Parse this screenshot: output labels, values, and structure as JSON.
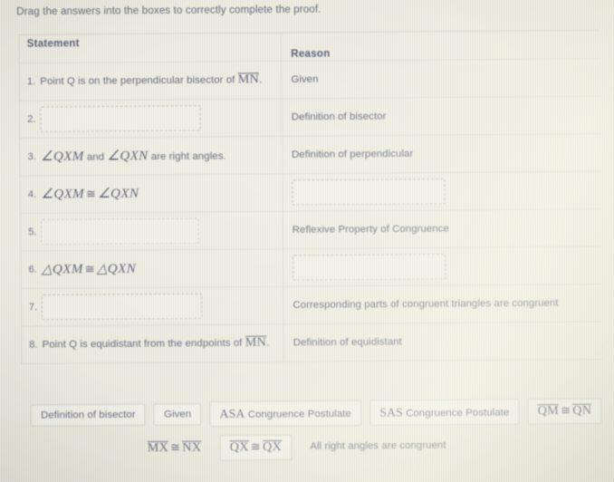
{
  "prompt": "Drag the answers into the boxes to correctly complete the proof.",
  "table": {
    "headers": {
      "statement": "Statement",
      "reason": "Reason"
    },
    "rows": [
      {
        "num": "1.",
        "statement_kind": "text",
        "statement_pre": "Point Q is on the perpendicular bisector of ",
        "statement_math": "MN",
        "statement_post": ".",
        "reason_kind": "text",
        "reason": "Given"
      },
      {
        "num": "2.",
        "statement_kind": "dropbox",
        "statement": "",
        "reason_kind": "text",
        "reason": "Definition of bisector"
      },
      {
        "num": "3.",
        "statement_kind": "angles",
        "statement_a": "∠QXM",
        "statement_mid": " and ",
        "statement_b": "∠QXN",
        "statement_post": " are right angles.",
        "reason_kind": "text",
        "reason": "Definition of perpendicular"
      },
      {
        "num": "4.",
        "statement_kind": "congruence",
        "statement_a": "∠QXM",
        "statement_sym": "≅",
        "statement_b": "∠QXN",
        "reason_kind": "dropbox",
        "reason": ""
      },
      {
        "num": "5.",
        "statement_kind": "dropbox",
        "statement": "",
        "reason_kind": "text",
        "reason": "Reflexive Property of Congruence"
      },
      {
        "num": "6.",
        "statement_kind": "congruence",
        "statement_a": "△QXM",
        "statement_sym": "≅",
        "statement_b": "△QXN",
        "reason_kind": "dropbox",
        "reason": ""
      },
      {
        "num": "7.",
        "statement_kind": "dropbox",
        "statement": "",
        "reason_kind": "text",
        "reason": "Corresponding parts of congruent triangles are congruent"
      },
      {
        "num": "8.",
        "statement_kind": "text",
        "statement_pre": "Point Q is equidistant from the endpoints of ",
        "statement_math": "MN",
        "statement_post": ".",
        "reason_kind": "text",
        "reason": "Definition of equidistant"
      }
    ]
  },
  "answer_tiles": {
    "row1": [
      {
        "kind": "text",
        "label": "Definition of bisector"
      },
      {
        "kind": "text",
        "label": "Given"
      },
      {
        "kind": "caps_text",
        "caps": "ASA",
        "label": " Congruence Postulate"
      },
      {
        "kind": "caps_text",
        "caps": "SAS",
        "label": " Congruence Postulate"
      },
      {
        "kind": "segment_congruence",
        "seg_a": "QM",
        "sym": "≅",
        "seg_b": "QN"
      }
    ],
    "row2": [
      {
        "kind": "segment_congruence",
        "seg_a": "MX",
        "sym": "≅",
        "seg_b": "NX",
        "plain": true
      },
      {
        "kind": "segment_congruence",
        "seg_a": "QX",
        "sym": "≅",
        "seg_b": "QX"
      },
      {
        "kind": "text",
        "label": "All right angles are congruent",
        "plain": true
      }
    ]
  },
  "colors": {
    "page_background": "#eceadf",
    "text": "#5a5f76",
    "table_border": "rgba(150,152,150,0.25)",
    "dropbox_border": "rgba(130,133,140,0.55)",
    "tile_border": "rgba(160,162,160,0.42)"
  }
}
